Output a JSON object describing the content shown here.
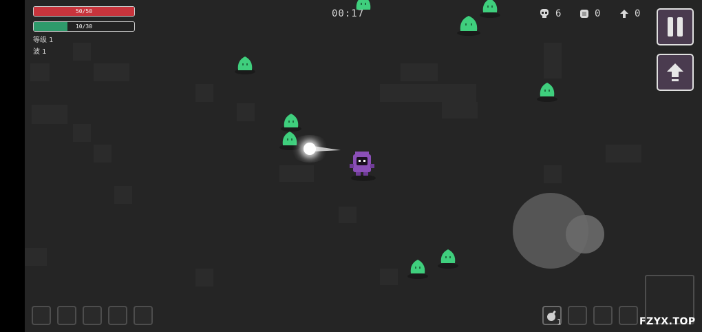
{
  "hud": {
    "hp_text": "50/50",
    "hp_fraction": 1.0,
    "xp_text": "10/30",
    "xp_fraction": 0.333,
    "level_label": "等级 1",
    "wave_label": "波 1"
  },
  "timer": "00:17",
  "stats": {
    "kills": "6",
    "coins": "0",
    "upgrades": "0"
  },
  "weapon_slot": {
    "item_icon": "bomb-icon",
    "count": "1"
  },
  "watermark": "FZYX.TOP",
  "colors": {
    "hp": "#c8343c",
    "xp": "#2e9a6b",
    "slime": "#3fcf7d",
    "player": "#8b4fb8",
    "button_bg": "#4a3b4f"
  },
  "enemies": {
    "type": "green-slime",
    "visible_count": 10
  }
}
